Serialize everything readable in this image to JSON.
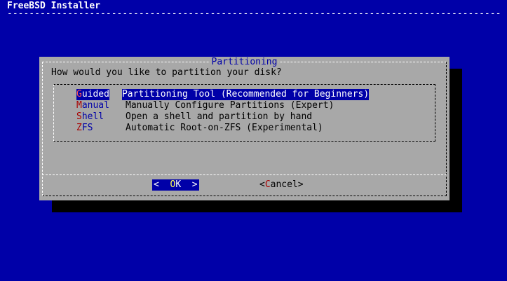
{
  "backtitle": "FreeBSD Installer",
  "backline": "--------------------------------------------------------------------------------------------------------------------",
  "dialog": {
    "title": "Partitioning",
    "prompt": "How would you like to partition your disk?",
    "items": [
      {
        "hotkey": "G",
        "rest": "uided",
        "description": "Partitioning Tool (Recommended for Beginners)",
        "selected": true
      },
      {
        "hotkey": "M",
        "rest": "anual",
        "description": "Manually Configure Partitions (Expert)",
        "selected": false
      },
      {
        "hotkey": "S",
        "rest": "hell",
        "description": "Open a shell and partition by hand",
        "selected": false
      },
      {
        "hotkey": "Z",
        "rest": "FS",
        "description": "Automatic Root-on-ZFS (Experimental)",
        "selected": false
      }
    ],
    "ok_button": {
      "left": "<  ",
      "hotkey": "O",
      "rest": "K",
      "right": "  >"
    },
    "cancel_button": {
      "left": "<",
      "hotkey": "C",
      "rest": "ancel",
      "right": ">"
    }
  }
}
